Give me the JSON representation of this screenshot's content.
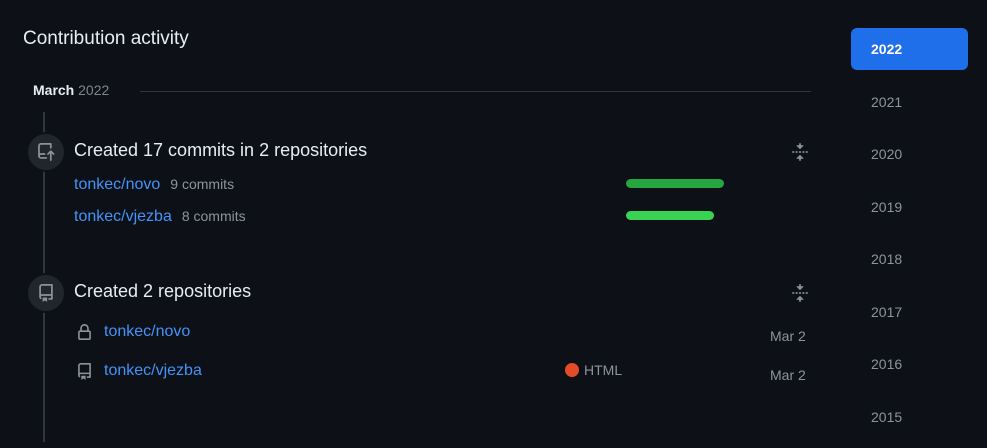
{
  "section_title": "Contribution activity",
  "month": {
    "name": "March",
    "year": "2022"
  },
  "commits": {
    "heading": "Created 17 commits in 2 repositories",
    "icon": "repo-push-icon",
    "repos": [
      {
        "name": "tonkec/novo",
        "count": "9 commits",
        "share": 1.0,
        "color": "#26a641"
      },
      {
        "name": "tonkec/vjezba",
        "count": "8 commits",
        "share": 0.9,
        "color": "#39d353"
      }
    ]
  },
  "created": {
    "heading": "Created 2 repositories",
    "icon": "repo-icon",
    "repos": [
      {
        "name": "tonkec/novo",
        "icon": "lock-icon",
        "language": "",
        "date": "Mar 2"
      },
      {
        "name": "tonkec/vjezba",
        "icon": "repo-icon",
        "language": "HTML",
        "language_color": "#e34c26",
        "date": "Mar 2"
      }
    ]
  },
  "years": [
    "2022",
    "2021",
    "2020",
    "2019",
    "2018",
    "2017",
    "2016",
    "2015"
  ],
  "active_year": "2022",
  "colors": {
    "accent": "#1f6feb",
    "link": "#4493f8",
    "background": "#0d1117"
  }
}
